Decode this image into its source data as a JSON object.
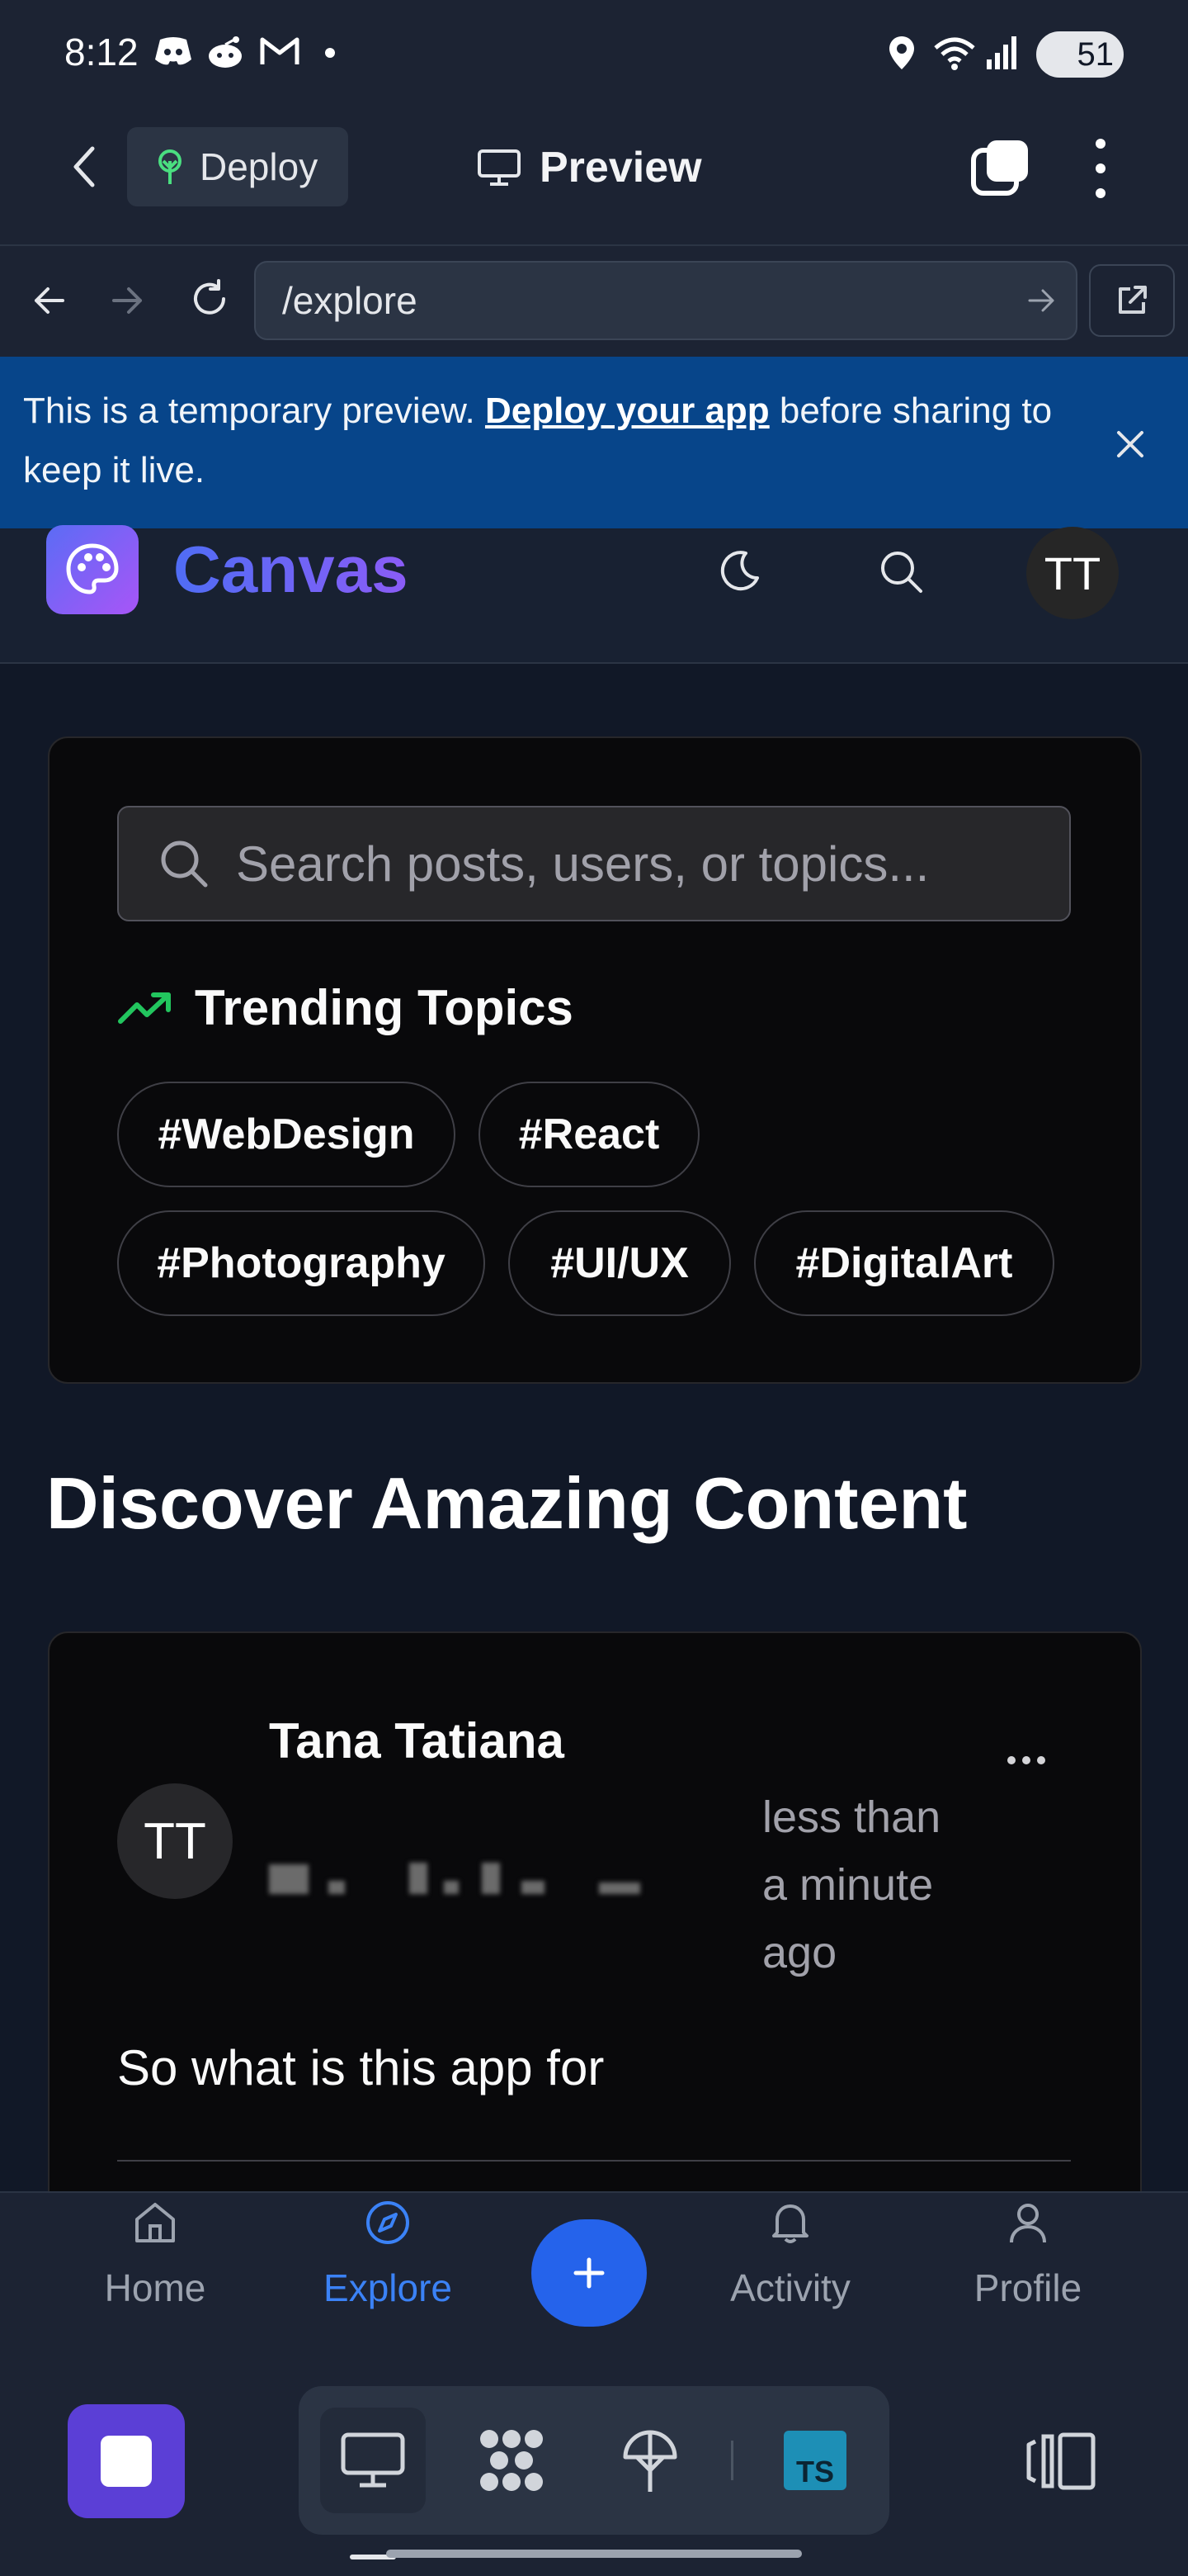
{
  "status_bar": {
    "time": "8:12",
    "battery": "51",
    "icons": [
      "discord-icon",
      "reddit-icon",
      "gmail-icon",
      "dot-icon",
      "location-icon",
      "wifi-icon",
      "signal-icon",
      "battery-icon"
    ]
  },
  "app_bar": {
    "deploy_label": "Deploy",
    "title": "Preview"
  },
  "browser": {
    "url": "/explore"
  },
  "banner": {
    "text_before": "This is a temporary preview. ",
    "link": "Deploy your app",
    "text_after": " before sharing to keep it live."
  },
  "site_header": {
    "logo": "Canvas",
    "avatar_initials": "TT"
  },
  "search": {
    "placeholder": "Search posts, users, or topics..."
  },
  "trending": {
    "title": "Trending Topics",
    "topics": [
      "#WebDesign",
      "#React",
      "#Photography",
      "#UI/UX",
      "#DigitalArt"
    ]
  },
  "discover": {
    "heading": "Discover Amazing Content"
  },
  "post": {
    "author": "Tana Tatiana",
    "avatar_initials": "TT",
    "time": "less than a minute ago",
    "body": "So what is this app for"
  },
  "bottom_nav": {
    "items": [
      {
        "label": "Home",
        "icon": "home-icon"
      },
      {
        "label": "Explore",
        "icon": "compass-icon"
      },
      {
        "label": "Activity",
        "icon": "bell-icon"
      },
      {
        "label": "Profile",
        "icon": "user-icon"
      }
    ],
    "active": "Explore"
  },
  "colors": {
    "accent": "#2563eb",
    "banner": "#07458a",
    "trending": "#22c55e",
    "logo_from": "#4f6df5",
    "logo_to": "#8b5cf6"
  }
}
